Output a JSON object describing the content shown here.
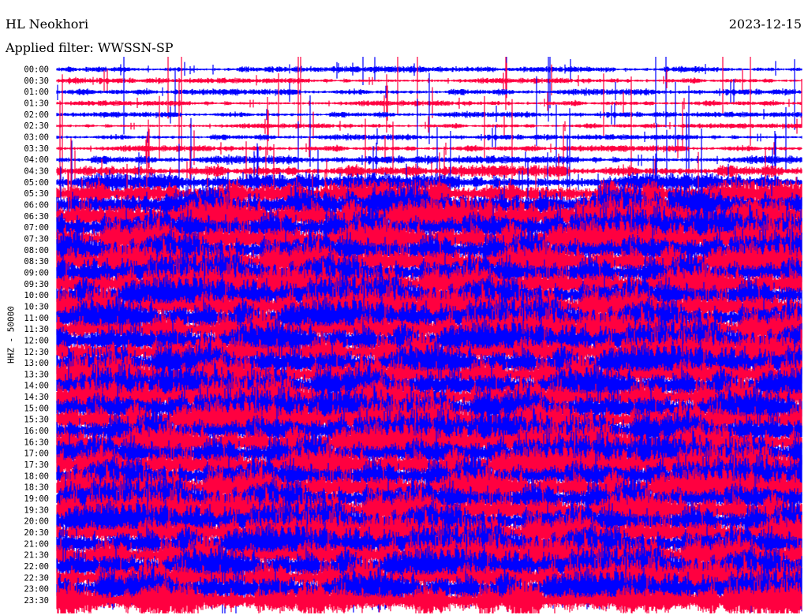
{
  "header": {
    "station": "HL Neokhori",
    "date": "2023-12-15",
    "filter": "Applied filter: WWSSN-SP"
  },
  "chart_data": {
    "type": "line",
    "title": "HL Neokhori",
    "subtitle": "Applied filter: WWSSN-SP",
    "ylabel": "HHZ - 50000",
    "xlabel": "",
    "colors": {
      "even": "#0000ff",
      "odd": "#ff0040"
    },
    "row_labels": [
      "00:00",
      "00:30",
      "01:00",
      "01:30",
      "02:00",
      "02:30",
      "03:00",
      "03:30",
      "04:00",
      "04:30",
      "05:00",
      "05:30",
      "06:00",
      "06:30",
      "07:00",
      "07:30",
      "08:00",
      "08:30",
      "09:00",
      "09:30",
      "10:00",
      "10:30",
      "11:00",
      "11:30",
      "12:00",
      "12:30",
      "13:00",
      "13:30",
      "14:00",
      "14:30",
      "15:00",
      "15:30",
      "16:00",
      "16:30",
      "17:00",
      "17:30",
      "18:00",
      "18:30",
      "19:00",
      "19:30",
      "20:00",
      "20:30",
      "21:00",
      "21:30",
      "22:00",
      "22:30",
      "23:00",
      "23:30"
    ],
    "relative_amplitude": [
      0.1,
      0.1,
      0.12,
      0.1,
      0.1,
      0.08,
      0.1,
      0.12,
      0.18,
      0.3,
      0.5,
      0.8,
      1,
      1,
      1,
      1,
      1,
      1,
      1,
      1,
      1,
      1,
      1,
      1,
      1,
      1,
      1,
      1,
      1,
      1,
      1,
      1,
      1,
      1,
      1,
      1,
      1,
      1,
      1,
      1,
      1,
      1,
      1,
      1,
      1,
      1,
      1,
      1
    ]
  }
}
